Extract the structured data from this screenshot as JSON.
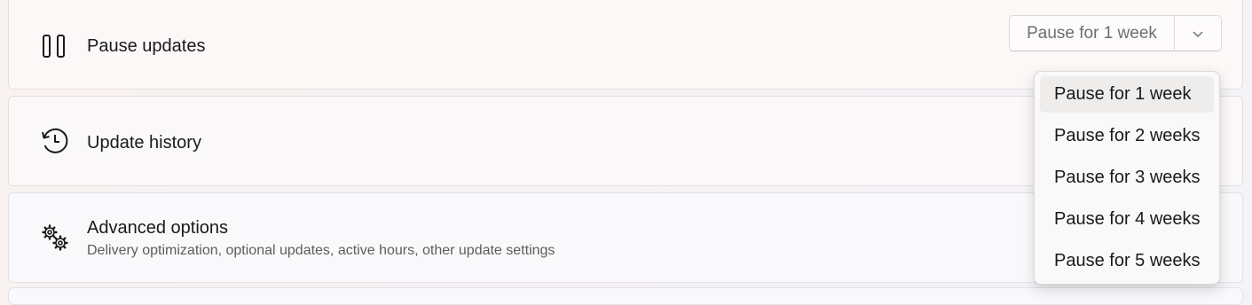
{
  "pause_updates": {
    "title": "Pause updates",
    "icon": "pause-icon",
    "selected_option": "Pause for 1 week"
  },
  "update_history": {
    "title": "Update history",
    "icon": "history-icon"
  },
  "advanced_options": {
    "title": "Advanced options",
    "subtitle": "Delivery optimization, optional updates, active hours, other update settings",
    "icon": "gears-icon"
  },
  "dropdown": {
    "options": [
      "Pause for 1 week",
      "Pause for 2 weeks",
      "Pause for 3 weeks",
      "Pause for 4 weeks",
      "Pause for 5 weeks"
    ],
    "selected_index": 0
  }
}
